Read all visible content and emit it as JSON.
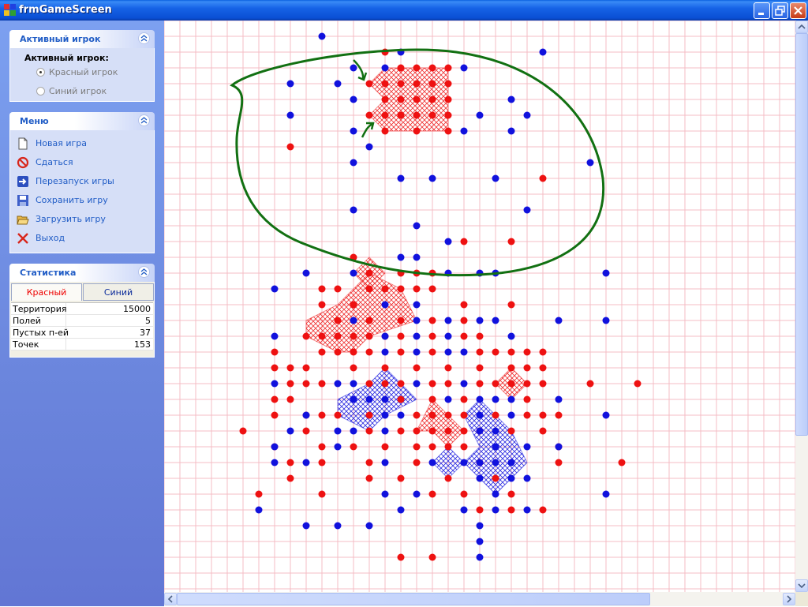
{
  "window": {
    "title": "frmGameScreen"
  },
  "colors": {
    "red": "#ee1111",
    "blue": "#1111dd",
    "grid": "#f4bcc4",
    "ellipse": "#127012"
  },
  "active_player": {
    "header": "Активный игрок",
    "label": "Активный игрок:",
    "options": [
      {
        "label": "Красный игрок",
        "selected": true
      },
      {
        "label": "Синий игрок",
        "selected": false
      }
    ]
  },
  "menu": {
    "header": "Меню",
    "items": [
      {
        "label": "Новая игра",
        "icon": "new-document-icon"
      },
      {
        "label": "Сдаться",
        "icon": "surrender-icon"
      },
      {
        "label": "Перезапуск игры",
        "icon": "restart-arrow-icon"
      },
      {
        "label": "Сохранить игру",
        "icon": "save-disk-icon"
      },
      {
        "label": "Загрузить игру",
        "icon": "open-folder-icon"
      },
      {
        "label": "Выход",
        "icon": "exit-x-icon"
      }
    ]
  },
  "statistics": {
    "header": "Статистика",
    "tabs": [
      {
        "label": "Красный",
        "selected": true
      },
      {
        "label": "Синий",
        "selected": false
      }
    ],
    "rows": [
      {
        "key": "Территория",
        "value": "15000"
      },
      {
        "key": "Полей",
        "value": "5"
      },
      {
        "key": "Пустых п-ей",
        "value": "37"
      },
      {
        "key": "Точек",
        "value": "153"
      }
    ]
  },
  "board": {
    "grid_columns": 40,
    "grid_rows": 37,
    "red_points": [
      [
        14,
        2
      ],
      [
        15,
        3
      ],
      [
        16,
        3
      ],
      [
        17,
        3
      ],
      [
        18,
        3
      ],
      [
        13,
        4
      ],
      [
        14,
        4
      ],
      [
        15,
        4
      ],
      [
        16,
        4
      ],
      [
        17,
        4
      ],
      [
        18,
        4
      ],
      [
        14,
        5
      ],
      [
        15,
        5
      ],
      [
        16,
        5
      ],
      [
        17,
        5
      ],
      [
        18,
        5
      ],
      [
        13,
        6
      ],
      [
        14,
        6
      ],
      [
        15,
        6
      ],
      [
        16,
        6
      ],
      [
        17,
        6
      ],
      [
        18,
        6
      ],
      [
        14,
        7
      ],
      [
        16,
        7
      ],
      [
        18,
        7
      ],
      [
        8,
        8
      ],
      [
        24,
        10
      ],
      [
        19,
        14
      ],
      [
        22,
        14
      ],
      [
        12,
        15
      ],
      [
        13,
        16
      ],
      [
        15,
        16
      ],
      [
        16,
        16
      ],
      [
        17,
        16
      ],
      [
        10,
        17
      ],
      [
        11,
        17
      ],
      [
        13,
        17
      ],
      [
        14,
        17
      ],
      [
        15,
        17
      ],
      [
        16,
        17
      ],
      [
        17,
        17
      ],
      [
        19,
        18
      ],
      [
        22,
        18
      ],
      [
        12,
        18
      ],
      [
        10,
        18
      ],
      [
        11,
        19
      ],
      [
        12,
        19
      ],
      [
        13,
        19
      ],
      [
        15,
        19
      ],
      [
        17,
        19
      ],
      [
        19,
        19
      ],
      [
        9,
        20
      ],
      [
        10,
        20
      ],
      [
        11,
        20
      ],
      [
        12,
        20
      ],
      [
        13,
        20
      ],
      [
        14,
        20
      ],
      [
        15,
        20
      ],
      [
        17,
        20
      ],
      [
        19,
        20
      ],
      [
        20,
        20
      ],
      [
        7,
        21
      ],
      [
        10,
        21
      ],
      [
        11,
        21
      ],
      [
        12,
        21
      ],
      [
        13,
        21
      ],
      [
        15,
        21
      ],
      [
        17,
        21
      ],
      [
        20,
        21
      ],
      [
        21,
        21
      ],
      [
        22,
        21
      ],
      [
        23,
        21
      ],
      [
        24,
        21
      ],
      [
        7,
        22
      ],
      [
        8,
        22
      ],
      [
        9,
        22
      ],
      [
        12,
        22
      ],
      [
        14,
        22
      ],
      [
        16,
        22
      ],
      [
        18,
        22
      ],
      [
        20,
        22
      ],
      [
        22,
        22
      ],
      [
        23,
        22
      ],
      [
        24,
        22
      ],
      [
        8,
        23
      ],
      [
        9,
        23
      ],
      [
        10,
        23
      ],
      [
        13,
        23
      ],
      [
        14,
        23
      ],
      [
        15,
        23
      ],
      [
        17,
        23
      ],
      [
        18,
        23
      ],
      [
        20,
        23
      ],
      [
        21,
        23
      ],
      [
        22,
        23
      ],
      [
        23,
        23
      ],
      [
        24,
        23
      ],
      [
        27,
        23
      ],
      [
        30,
        23
      ],
      [
        7,
        24
      ],
      [
        8,
        24
      ],
      [
        15,
        24
      ],
      [
        17,
        24
      ],
      [
        19,
        24
      ],
      [
        23,
        24
      ],
      [
        7,
        25
      ],
      [
        9,
        25
      ],
      [
        10,
        25
      ],
      [
        11,
        25
      ],
      [
        13,
        25
      ],
      [
        16,
        25
      ],
      [
        17,
        25
      ],
      [
        18,
        25
      ],
      [
        19,
        25
      ],
      [
        21,
        25
      ],
      [
        23,
        25
      ],
      [
        24,
        25
      ],
      [
        25,
        25
      ],
      [
        5,
        26
      ],
      [
        9,
        26
      ],
      [
        13,
        26
      ],
      [
        15,
        26
      ],
      [
        16,
        26
      ],
      [
        17,
        26
      ],
      [
        18,
        26
      ],
      [
        19,
        26
      ],
      [
        20,
        26
      ],
      [
        22,
        26
      ],
      [
        24,
        26
      ],
      [
        7,
        27
      ],
      [
        10,
        27
      ],
      [
        12,
        27
      ],
      [
        14,
        27
      ],
      [
        16,
        27
      ],
      [
        17,
        27
      ],
      [
        18,
        27
      ],
      [
        19,
        27
      ],
      [
        25,
        27
      ],
      [
        8,
        28
      ],
      [
        10,
        28
      ],
      [
        13,
        28
      ],
      [
        16,
        28
      ],
      [
        20,
        28
      ],
      [
        25,
        28
      ],
      [
        29,
        28
      ],
      [
        8,
        29
      ],
      [
        13,
        29
      ],
      [
        15,
        29
      ],
      [
        18,
        29
      ],
      [
        21,
        29
      ],
      [
        6,
        30
      ],
      [
        10,
        30
      ],
      [
        17,
        30
      ],
      [
        19,
        30
      ],
      [
        22,
        30
      ],
      [
        20,
        31
      ],
      [
        22,
        31
      ],
      [
        24,
        31
      ],
      [
        15,
        34
      ],
      [
        17,
        34
      ]
    ],
    "blue_points": [
      [
        10,
        1
      ],
      [
        15,
        2
      ],
      [
        24,
        2
      ],
      [
        12,
        3
      ],
      [
        14,
        3
      ],
      [
        19,
        3
      ],
      [
        8,
        4
      ],
      [
        11,
        4
      ],
      [
        12,
        5
      ],
      [
        22,
        5
      ],
      [
        8,
        6
      ],
      [
        20,
        6
      ],
      [
        23,
        6
      ],
      [
        12,
        7
      ],
      [
        19,
        7
      ],
      [
        22,
        7
      ],
      [
        13,
        8
      ],
      [
        12,
        9
      ],
      [
        15,
        10
      ],
      [
        17,
        10
      ],
      [
        21,
        10
      ],
      [
        27,
        9
      ],
      [
        12,
        12
      ],
      [
        23,
        12
      ],
      [
        16,
        13
      ],
      [
        18,
        14
      ],
      [
        15,
        15
      ],
      [
        16,
        15
      ],
      [
        12,
        16
      ],
      [
        18,
        16
      ],
      [
        20,
        16
      ],
      [
        21,
        16
      ],
      [
        9,
        16
      ],
      [
        7,
        17
      ],
      [
        28,
        16
      ],
      [
        12,
        19
      ],
      [
        16,
        19
      ],
      [
        18,
        19
      ],
      [
        20,
        19
      ],
      [
        21,
        19
      ],
      [
        16,
        18
      ],
      [
        14,
        18
      ],
      [
        14,
        20
      ],
      [
        16,
        20
      ],
      [
        18,
        20
      ],
      [
        22,
        20
      ],
      [
        25,
        19
      ],
      [
        28,
        19
      ],
      [
        7,
        20
      ],
      [
        16,
        21
      ],
      [
        18,
        21
      ],
      [
        19,
        21
      ],
      [
        14,
        21
      ],
      [
        7,
        23
      ],
      [
        11,
        23
      ],
      [
        12,
        23
      ],
      [
        16,
        23
      ],
      [
        19,
        23
      ],
      [
        12,
        24
      ],
      [
        13,
        24
      ],
      [
        14,
        24
      ],
      [
        18,
        24
      ],
      [
        20,
        24
      ],
      [
        21,
        24
      ],
      [
        22,
        24
      ],
      [
        25,
        24
      ],
      [
        9,
        25
      ],
      [
        14,
        25
      ],
      [
        15,
        25
      ],
      [
        20,
        25
      ],
      [
        22,
        25
      ],
      [
        28,
        25
      ],
      [
        8,
        26
      ],
      [
        11,
        26
      ],
      [
        12,
        26
      ],
      [
        14,
        26
      ],
      [
        20,
        26
      ],
      [
        21,
        26
      ],
      [
        7,
        27
      ],
      [
        11,
        27
      ],
      [
        21,
        27
      ],
      [
        23,
        27
      ],
      [
        25,
        27
      ],
      [
        7,
        28
      ],
      [
        9,
        28
      ],
      [
        14,
        28
      ],
      [
        17,
        28
      ],
      [
        19,
        28
      ],
      [
        20,
        28
      ],
      [
        21,
        28
      ],
      [
        22,
        28
      ],
      [
        20,
        29
      ],
      [
        22,
        29
      ],
      [
        23,
        29
      ],
      [
        14,
        30
      ],
      [
        16,
        30
      ],
      [
        21,
        30
      ],
      [
        28,
        30
      ],
      [
        6,
        31
      ],
      [
        15,
        31
      ],
      [
        19,
        31
      ],
      [
        21,
        31
      ],
      [
        23,
        31
      ],
      [
        9,
        32
      ],
      [
        11,
        32
      ],
      [
        13,
        32
      ],
      [
        20,
        32
      ],
      [
        20,
        33
      ],
      [
        20,
        34
      ]
    ],
    "red_regions": [
      [
        [
          13,
          4
        ],
        [
          14,
          3
        ],
        [
          18,
          3
        ],
        [
          18,
          7
        ],
        [
          14,
          7
        ],
        [
          13,
          6
        ],
        [
          14,
          5
        ]
      ],
      [
        [
          12,
          16
        ],
        [
          13,
          15
        ],
        [
          14,
          16
        ],
        [
          13,
          17
        ]
      ],
      [
        [
          9,
          19
        ],
        [
          11,
          18
        ],
        [
          12,
          17
        ],
        [
          13,
          16
        ],
        [
          15,
          17
        ],
        [
          16,
          19
        ],
        [
          13,
          20
        ],
        [
          12,
          21
        ],
        [
          11,
          21
        ],
        [
          9,
          20
        ]
      ],
      [
        [
          21,
          23
        ],
        [
          22,
          22
        ],
        [
          23,
          23
        ],
        [
          22,
          24
        ]
      ],
      [
        [
          17,
          24
        ],
        [
          18,
          25
        ],
        [
          19,
          26
        ],
        [
          18,
          27
        ],
        [
          17,
          26
        ],
        [
          16,
          26
        ]
      ]
    ],
    "blue_regions": [
      [
        [
          11,
          24
        ],
        [
          13,
          23
        ],
        [
          14,
          22
        ],
        [
          16,
          24
        ],
        [
          14,
          25
        ],
        [
          13,
          26
        ],
        [
          11,
          25
        ]
      ],
      [
        [
          17,
          28
        ],
        [
          18,
          27
        ],
        [
          19,
          28
        ],
        [
          18,
          29
        ]
      ],
      [
        [
          19,
          25
        ],
        [
          20,
          24
        ],
        [
          22,
          26
        ],
        [
          23,
          28
        ],
        [
          21,
          30
        ],
        [
          20,
          29
        ],
        [
          19,
          28
        ],
        [
          20,
          27
        ]
      ]
    ]
  }
}
